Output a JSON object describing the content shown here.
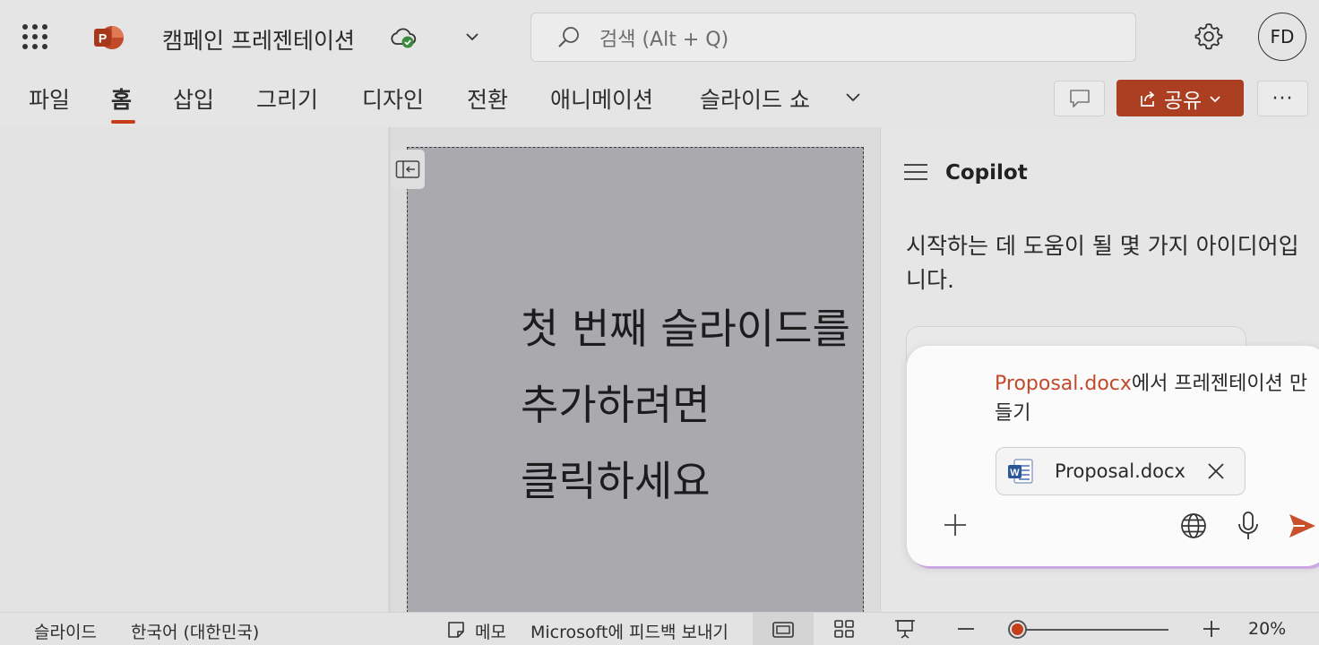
{
  "app": {
    "document_title": "캠페인 프레젠테이션",
    "search_placeholder": "검색 (Alt + Q)",
    "user_initials": "FD",
    "brand_color": "#c43e1c",
    "share_color": "#ac3e21"
  },
  "ribbon": {
    "tabs": [
      {
        "label": "파일"
      },
      {
        "label": "홈",
        "active": true
      },
      {
        "label": "삽입"
      },
      {
        "label": "그리기"
      },
      {
        "label": "디자인"
      },
      {
        "label": "전환"
      },
      {
        "label": "애니메이션"
      },
      {
        "label": "슬라이드 쇼"
      }
    ],
    "share_label": "공유"
  },
  "slide": {
    "placeholder_lines": [
      "첫 번째 슬라이드를",
      "추가하려면",
      "클릭하세요"
    ]
  },
  "copilot": {
    "title": "Copilot",
    "intro": "시작하는 데 도움이 될 몇 가지 아이디어입니다.",
    "composer": {
      "reference": "Proposal.docx",
      "prompt_suffix": "에서 프레젠테이션 만들기",
      "attachment_name": "Proposal.docx"
    }
  },
  "status": {
    "slide_label": "슬라이드",
    "language": "한국어 (대한민국)",
    "notes_label": "메모",
    "feedback": "Microsoft에 피드백 보내기",
    "zoom_percent": "20%",
    "zoom_level": 20
  },
  "icons": {
    "app_launcher": "waffle-icon",
    "cloud": "cloud-saved-icon",
    "search": "search-icon",
    "settings": "gear-icon",
    "comment": "comment-icon",
    "share": "share-icon",
    "more": "more-icon",
    "collapse": "collapse-pane-icon",
    "menu": "hamburger-icon",
    "word": "word-file-icon",
    "close": "close-icon",
    "add": "plus-icon",
    "globe": "globe-icon",
    "mic": "microphone-icon",
    "send": "send-icon"
  }
}
